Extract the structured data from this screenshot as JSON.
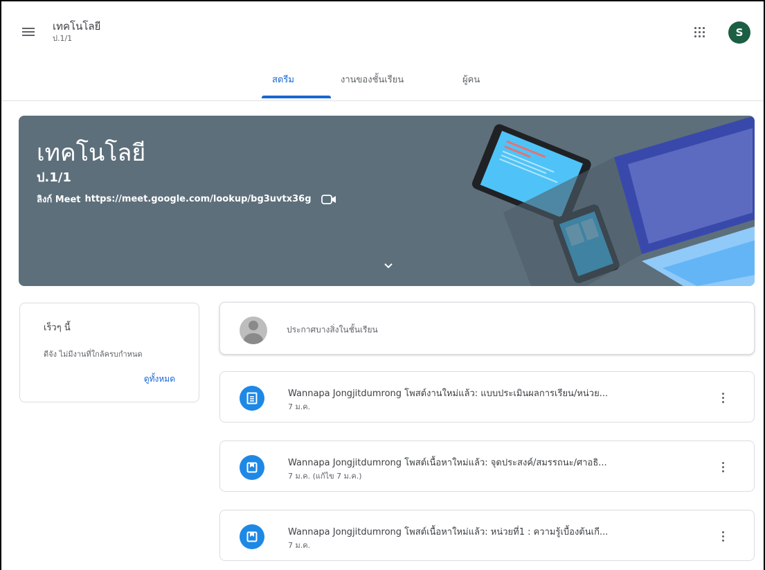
{
  "header": {
    "title": "เทคโนโลยี",
    "subtitle": "ป.1/1",
    "avatar_letter": "S"
  },
  "tabs": [
    {
      "label": "สตรีม",
      "active": true
    },
    {
      "label": "งานของชั้นเรียน",
      "active": false
    },
    {
      "label": "ผู้คน",
      "active": false
    }
  ],
  "banner": {
    "title": "เทคโนโลยี",
    "section": "ป.1/1",
    "meet_label": "ลิงก์ Meet",
    "meet_link": "https://meet.google.com/lookup/bg3uvtx36g",
    "color": "#5d6f7b"
  },
  "upcoming": {
    "title": "เร็วๆ นี้",
    "description": "ดีจัง ไม่มีงานที่ใกล้ครบกำหนด",
    "view_all": "ดูทั้งหมด"
  },
  "announce": {
    "placeholder": "ประกาศบางสิ่งในชั้นเรียน"
  },
  "posts": [
    {
      "title": "Wannapa Jongjitdumrong โพสต์งานใหม่แล้ว: แบบประเมินผลการเรียน/หน่วย...",
      "date": "7 ม.ค.",
      "icon": "assignment-icon"
    },
    {
      "title": "Wannapa Jongjitdumrong โพสต์เนื้อหาใหม่แล้ว: จุดประสงค์/สมรรถนะ/ศาอธิ...",
      "date": "7 ม.ค. (แก้ไข 7 ม.ค.)",
      "icon": "material-icon"
    },
    {
      "title": "Wannapa Jongjitdumrong โพสต์เนื้อหาใหม่แล้ว: หน่วยที่1 : ความรู้เบื้องต้นเกี...",
      "date": "7 ม.ค.",
      "icon": "material-icon"
    }
  ],
  "colors": {
    "accent": "#1967d2",
    "avatar": "#1b5e43",
    "post_icon": "#1e88e5"
  }
}
